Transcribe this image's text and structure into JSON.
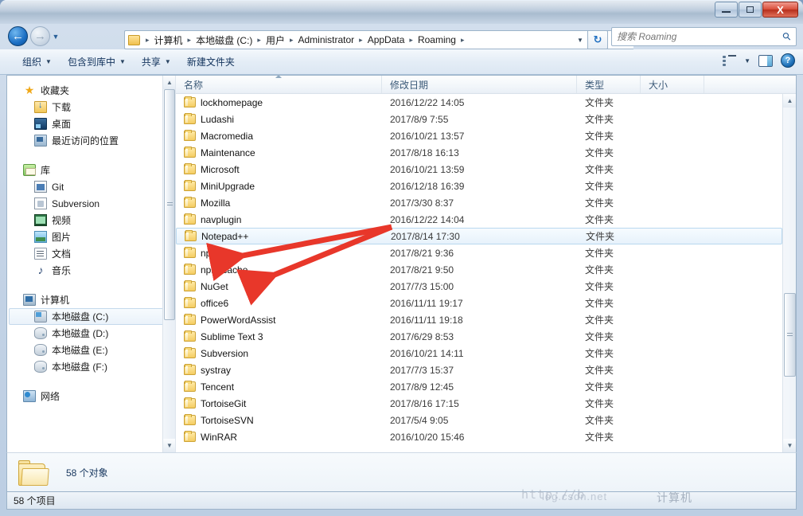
{
  "window": {
    "controls": {
      "minimize": "–",
      "maximize": "□",
      "close": "X"
    }
  },
  "address": {
    "back_icon": "←",
    "forward_icon": "→",
    "history_caret": "▼",
    "folder_icon": "folder-icon",
    "crumbs": [
      "计算机",
      "本地磁盘 (C:)",
      "用户",
      "Administrator",
      "AppData",
      "Roaming"
    ],
    "separator": "▸",
    "dropdown_caret": "▼",
    "refresh_icon": "↻"
  },
  "search": {
    "placeholder": "搜索 Roaming",
    "icon": "search-icon"
  },
  "toolbar": {
    "organize": "组织",
    "include_in_library": "包含到库中",
    "share": "共享",
    "new_folder": "新建文件夹",
    "caret": "▼",
    "view_icon": "view-layout-icon",
    "preview_pane_icon": "preview-pane-icon",
    "help_icon": "?"
  },
  "sidebar": {
    "groups": [
      {
        "header": {
          "label": "收藏夹",
          "icon": "star-icon"
        },
        "items": [
          {
            "label": "下载",
            "icon": "downloads-icon"
          },
          {
            "label": "桌面",
            "icon": "desktop-icon"
          },
          {
            "label": "最近访问的位置",
            "icon": "recent-places-icon"
          }
        ]
      },
      {
        "header": {
          "label": "库",
          "icon": "library-icon"
        },
        "items": [
          {
            "label": "Git",
            "icon": "git-icon"
          },
          {
            "label": "Subversion",
            "icon": "subversion-icon"
          },
          {
            "label": "视频",
            "icon": "video-icon"
          },
          {
            "label": "图片",
            "icon": "pictures-icon"
          },
          {
            "label": "文档",
            "icon": "documents-icon"
          },
          {
            "label": "音乐",
            "icon": "music-icon"
          }
        ]
      },
      {
        "header": {
          "label": "计算机",
          "icon": "computer-icon"
        },
        "items": [
          {
            "label": "本地磁盘 (C:)",
            "icon": "hdd-system-icon",
            "selected": true
          },
          {
            "label": "本地磁盘 (D:)",
            "icon": "hdd-icon"
          },
          {
            "label": "本地磁盘 (E:)",
            "icon": "hdd-icon"
          },
          {
            "label": "本地磁盘 (F:)",
            "icon": "hdd-icon"
          }
        ]
      },
      {
        "header": {
          "label": "网络",
          "icon": "network-icon"
        },
        "items": []
      }
    ],
    "scroll_up": "▲",
    "scroll_down": "▼"
  },
  "list": {
    "columns": [
      {
        "label": "名称",
        "sorted": "asc"
      },
      {
        "label": "修改日期"
      },
      {
        "label": "类型"
      },
      {
        "label": "大小"
      }
    ],
    "rows": [
      {
        "name": "lockhomepage",
        "date": "2016/12/22 14:05",
        "type": "文件夹",
        "size": ""
      },
      {
        "name": "Ludashi",
        "date": "2017/8/9 7:55",
        "type": "文件夹",
        "size": ""
      },
      {
        "name": "Macromedia",
        "date": "2016/10/21 13:57",
        "type": "文件夹",
        "size": ""
      },
      {
        "name": "Maintenance",
        "date": "2017/8/18 16:13",
        "type": "文件夹",
        "size": ""
      },
      {
        "name": "Microsoft",
        "date": "2016/10/21 13:59",
        "type": "文件夹",
        "size": ""
      },
      {
        "name": "MiniUpgrade",
        "date": "2016/12/18 16:39",
        "type": "文件夹",
        "size": ""
      },
      {
        "name": "Mozilla",
        "date": "2017/3/30 8:37",
        "type": "文件夹",
        "size": ""
      },
      {
        "name": "navplugin",
        "date": "2016/12/22 14:04",
        "type": "文件夹",
        "size": ""
      },
      {
        "name": "Notepad++",
        "date": "2017/8/14 17:30",
        "type": "文件夹",
        "size": "",
        "selected": true
      },
      {
        "name": "npm",
        "date": "2017/8/21 9:36",
        "type": "文件夹",
        "size": ""
      },
      {
        "name": "npm-cache",
        "date": "2017/8/21 9:50",
        "type": "文件夹",
        "size": ""
      },
      {
        "name": "NuGet",
        "date": "2017/7/3 15:00",
        "type": "文件夹",
        "size": ""
      },
      {
        "name": "office6",
        "date": "2016/11/11 19:17",
        "type": "文件夹",
        "size": ""
      },
      {
        "name": "PowerWordAssist",
        "date": "2016/11/11 19:18",
        "type": "文件夹",
        "size": ""
      },
      {
        "name": "Sublime Text 3",
        "date": "2017/6/29 8:53",
        "type": "文件夹",
        "size": ""
      },
      {
        "name": "Subversion",
        "date": "2016/10/21 14:11",
        "type": "文件夹",
        "size": ""
      },
      {
        "name": "systray",
        "date": "2017/7/3 15:37",
        "type": "文件夹",
        "size": ""
      },
      {
        "name": "Tencent",
        "date": "2017/8/9 12:45",
        "type": "文件夹",
        "size": ""
      },
      {
        "name": "TortoiseGit",
        "date": "2017/8/16 17:15",
        "type": "文件夹",
        "size": ""
      },
      {
        "name": "TortoiseSVN",
        "date": "2017/5/4 9:05",
        "type": "文件夹",
        "size": ""
      },
      {
        "name": "WinRAR",
        "date": "2016/10/20 15:46",
        "type": "文件夹",
        "size": ""
      }
    ],
    "scroll_up": "▲",
    "scroll_down": "▼"
  },
  "details": {
    "icon": "open-folder-icon",
    "text": "58 个对象"
  },
  "status": {
    "text": "58 个项目"
  },
  "watermark": {
    "line1": "http://b",
    "line2": "log.csdn.net",
    "line3": "计算机"
  },
  "annotations": {
    "arrow_color": "#e8372a",
    "targets": [
      "npm",
      "npm-cache"
    ]
  }
}
